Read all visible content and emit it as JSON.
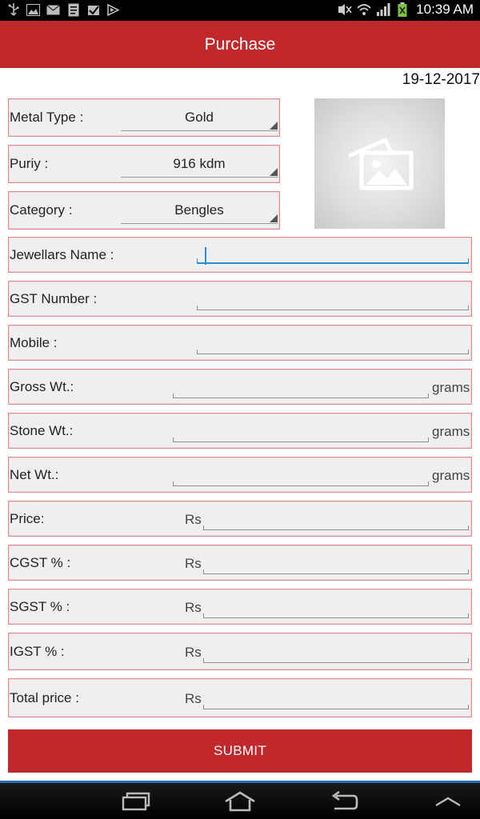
{
  "status_bar": {
    "time": "10:39 AM",
    "left_icons": [
      "usb-icon",
      "image-icon",
      "mail-icon",
      "document-icon",
      "check-icon",
      "play-icon"
    ],
    "right_icons": [
      "mute-icon",
      "wifi-icon",
      "signal-icon",
      "battery-icon"
    ]
  },
  "app_bar": {
    "title": "Purchase"
  },
  "date": "19-12-2017",
  "form": {
    "metal_type": {
      "label": "Metal Type :",
      "value": "Gold"
    },
    "purity": {
      "label": "Puriy :",
      "value": "916 kdm"
    },
    "category": {
      "label": "Category :",
      "value": "Bengles"
    },
    "image_placeholder": "image-placeholder-icon",
    "jewellers_name": {
      "label": "Jewellars Name :",
      "value": ""
    },
    "gst_number": {
      "label": "GST Number :",
      "value": ""
    },
    "mobile": {
      "label": "Mobile :",
      "value": ""
    },
    "gross_wt": {
      "label": "Gross Wt.:",
      "value": "",
      "unit": "grams"
    },
    "stone_wt": {
      "label": "Stone Wt.:",
      "value": "",
      "unit": "grams"
    },
    "net_wt": {
      "label": "Net Wt.:",
      "value": "",
      "unit": "grams"
    },
    "price": {
      "label": "Price:",
      "currency": "Rs",
      "value": ""
    },
    "cgst": {
      "label": "CGST % :",
      "currency": "Rs",
      "value": ""
    },
    "sgst": {
      "label": "SGST % :",
      "currency": "Rs",
      "value": ""
    },
    "igst": {
      "label": "IGST % :",
      "currency": "Rs",
      "value": ""
    },
    "total_price": {
      "label": "Total price :",
      "currency": "Rs",
      "value": ""
    },
    "submit_label": "SUBMIT"
  },
  "nav_bar": {
    "buttons": [
      "recent-apps-icon",
      "home-icon",
      "back-icon",
      "menu-up-icon"
    ]
  },
  "colors": {
    "primary": "#c0282b",
    "field_border": "#e58a8f",
    "field_bg": "#efefef",
    "accent": "#2a8fd0"
  }
}
